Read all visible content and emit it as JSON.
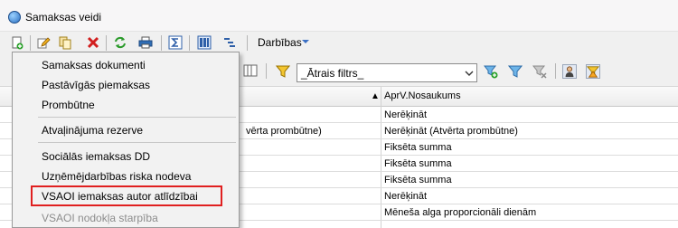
{
  "window": {
    "title": "Samaksas veidi",
    "app_icon": "app-globe-icon"
  },
  "toolbar": {
    "menu_label": "Darbības",
    "icons": [
      "new-icon",
      "edit-icon",
      "copy-icon",
      "delete-icon",
      "refresh-icon",
      "print-icon",
      "sum-icon",
      "columns-icon",
      "tree-icon"
    ]
  },
  "filter": {
    "combo_value": "_Ātrais filtrs_"
  },
  "grid": {
    "column2_header": "AprV.Nosaukums",
    "rows": [
      {
        "col1": "",
        "col2": "Nerēķināt"
      },
      {
        "col1": "vērta prombūtne)",
        "col2": "Nerēķināt (Atvērta prombūtne)"
      },
      {
        "col1": "",
        "col2": "Fiksēta summa"
      },
      {
        "col1": "",
        "col2": "Fiksēta summa"
      },
      {
        "col1": "",
        "col2": "Fiksēta summa"
      },
      {
        "col1": "",
        "col2": "Nerēķināt"
      },
      {
        "col1": "",
        "col2": "Mēneša alga proporcionāli dienām"
      }
    ]
  },
  "menu": {
    "items": [
      "Samaksas dokumenti",
      "Pastāvīgās piemaksas",
      "Prombūtne",
      "Atvaļinājuma rezerve",
      "Sociālās iemaksas DD",
      "Uzņēmējdarbības riska nodeva",
      "VSAOI iemaksas autor atlīdzībai",
      "VSAOI nodokļa starpība"
    ],
    "highlight_color": "#e02020"
  }
}
